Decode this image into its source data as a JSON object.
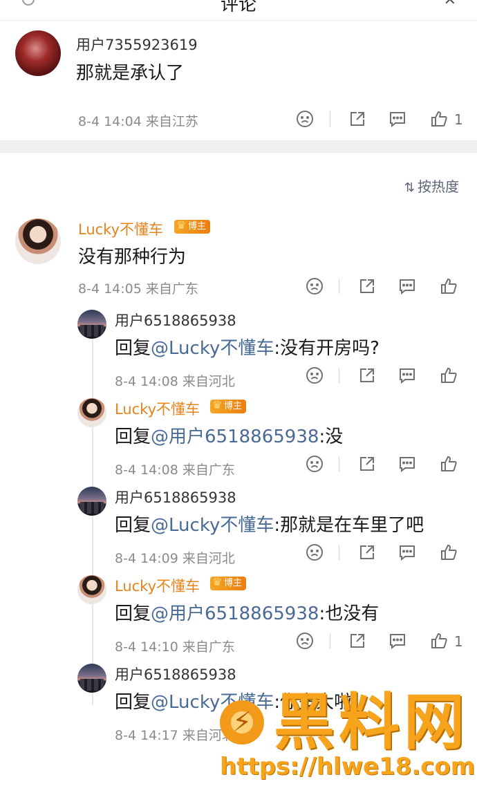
{
  "topbar": {
    "title": "评论"
  },
  "sort": {
    "label": "按热度"
  },
  "comments": [
    {
      "user": "用户7355923619",
      "text": "那就是承认了",
      "meta": "8-4 14:04  来自江苏",
      "likes": "1"
    },
    {
      "user": "Lucky不懂车",
      "badge": "博主",
      "text": "没有那种行为",
      "meta": "8-4 14:05  来自广东",
      "likes": ""
    }
  ],
  "replies": [
    {
      "user": "用户6518865938",
      "prefix": "回复",
      "at": "@Lucky不懂车",
      "text": ":没有开房吗?",
      "meta": "8-4 14:08  来自河北",
      "likes": ""
    },
    {
      "user": "Lucky不懂车",
      "badge": "博主",
      "prefix": "回复",
      "at": "@用户6518865938",
      "text": ":没",
      "meta": "8-4 14:08  来自广东",
      "likes": ""
    },
    {
      "user": "用户6518865938",
      "prefix": "回复",
      "at": "@Lucky不懂车",
      "text": ":那就是在车里了吧",
      "meta": "8-4 14:09  来自河北",
      "likes": ""
    },
    {
      "user": "Lucky不懂车",
      "badge": "博主",
      "prefix": "回复",
      "at": "@用户6518865938",
      "text": ":也没有",
      "meta": "8-4 14:10  来自广东",
      "likes": "1"
    },
    {
      "user": "用户6518865938",
      "prefix": "回复",
      "at": "@Lucky不懂车",
      "text": ":你多大啦",
      "meta": "8-4 14:17  来自河北",
      "likes": ""
    }
  ],
  "watermark": {
    "title": "黑料网",
    "url": "https://hlwe18.com"
  },
  "icons": [
    "back-icon",
    "close-icon",
    "dislike-icon",
    "share-icon",
    "reply-icon",
    "like-icon",
    "sort-icon",
    "blogger-crown-icon"
  ],
  "colors": {
    "at_link": "#4a6a96",
    "blogger_name": "#e8821b",
    "badge": "#f5a623",
    "meta": "#8a8a8a"
  }
}
